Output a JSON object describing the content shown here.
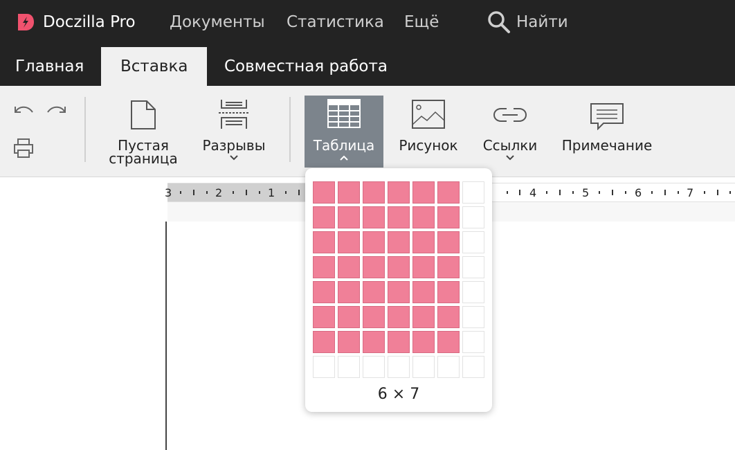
{
  "app": {
    "title": "Doczilla Pro"
  },
  "topnav": {
    "documents": "Документы",
    "statistics": "Статистика",
    "more": "Ещё",
    "search": "Найти"
  },
  "tabs": {
    "home": "Главная",
    "insert": "Вставка",
    "collab": "Совместная работа"
  },
  "ribbon": {
    "blank_page_line1": "Пустая",
    "blank_page_line2": "страница",
    "breaks": "Разрывы",
    "table": "Таблица",
    "picture": "Рисунок",
    "links": "Ссылки",
    "note": "Примечание"
  },
  "ruler": {
    "labels": [
      "3",
      "2",
      "1",
      "4",
      "5",
      "6",
      "7"
    ]
  },
  "table_picker": {
    "columns": 7,
    "rows": 8,
    "selected_cols": 6,
    "selected_rows": 7,
    "size_label": "6 × 7"
  },
  "colors": {
    "accent": "#f08098",
    "topbar": "#232323",
    "active_button": "#7c848c"
  }
}
